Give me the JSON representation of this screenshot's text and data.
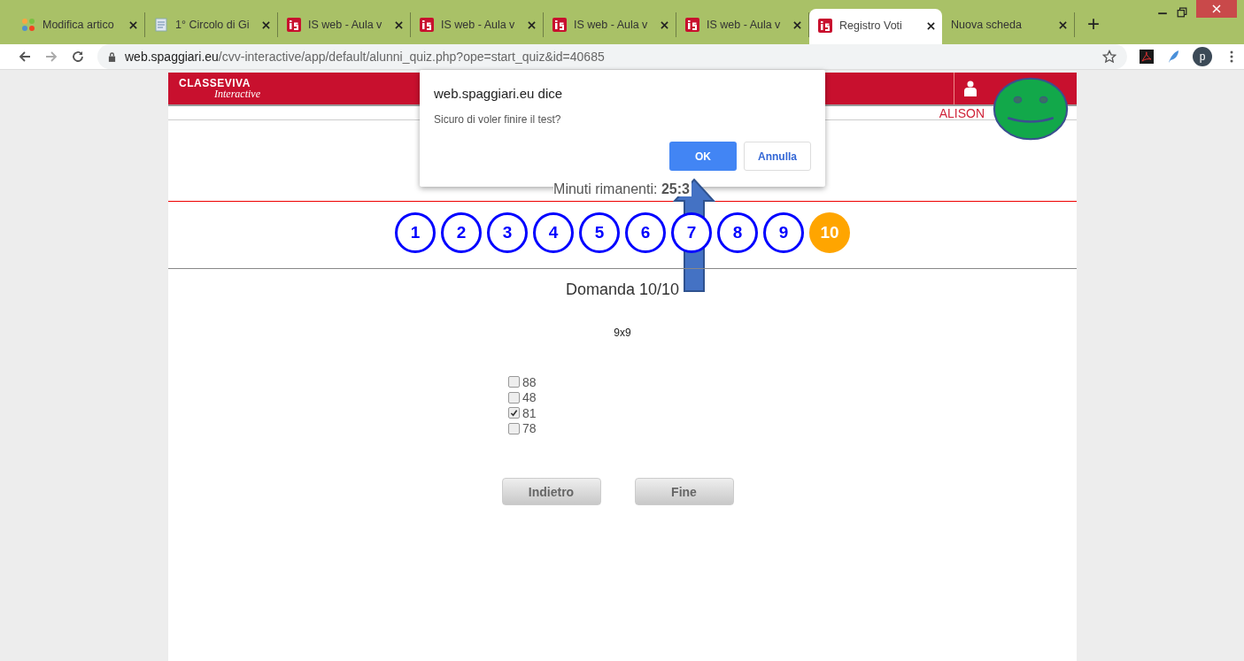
{
  "browser": {
    "tabs": [
      {
        "title": "Modifica artico",
        "kind": "joomla",
        "selected": false
      },
      {
        "title": "1° Circolo di Gi",
        "kind": "document",
        "selected": false
      },
      {
        "title": "IS web - Aula v",
        "kind": "is",
        "selected": false
      },
      {
        "title": "IS web - Aula v",
        "kind": "is",
        "selected": false
      },
      {
        "title": "IS web - Aula v",
        "kind": "is",
        "selected": false
      },
      {
        "title": "IS web - Aula v",
        "kind": "is",
        "selected": false
      },
      {
        "title": "Registro Voti",
        "kind": "is",
        "selected": true
      },
      {
        "title": "Nuova scheda",
        "kind": "plain",
        "selected": false
      }
    ],
    "new_tab": "+",
    "url_host": "web.spaggiari.eu",
    "url_path": "/cvv-interactive/app/default/alunni_quiz.php?ope=start_quiz&id=40685",
    "profile": "p"
  },
  "header": {
    "logo_top": "CLASSEVIVA",
    "logo_bottom": "Interactive",
    "user_name": "ALISON"
  },
  "timer": {
    "label": "Minuti rimanenti:",
    "value": "25:3"
  },
  "questions": [
    {
      "number": "1",
      "selected": false
    },
    {
      "number": "2",
      "selected": false
    },
    {
      "number": "3",
      "selected": false
    },
    {
      "number": "4",
      "selected": false
    },
    {
      "number": "5",
      "selected": false
    },
    {
      "number": "6",
      "selected": false
    },
    {
      "number": "7",
      "selected": false
    },
    {
      "number": "8",
      "selected": false
    },
    {
      "number": "9",
      "selected": false
    },
    {
      "number": "10",
      "selected": true
    }
  ],
  "question": {
    "title": "Domanda 10/10",
    "text": "9x9",
    "answers": [
      {
        "label": "88",
        "checked": false
      },
      {
        "label": "48",
        "checked": false
      },
      {
        "label": "81",
        "checked": true
      },
      {
        "label": "78",
        "checked": false
      }
    ]
  },
  "buttons": [
    "Indietro",
    "Fine"
  ],
  "dialog": {
    "title": "web.spaggiari.eu dice",
    "message": "Sicuro di voler finire il test?",
    "ok": "OK",
    "cancel": "Annulla"
  }
}
